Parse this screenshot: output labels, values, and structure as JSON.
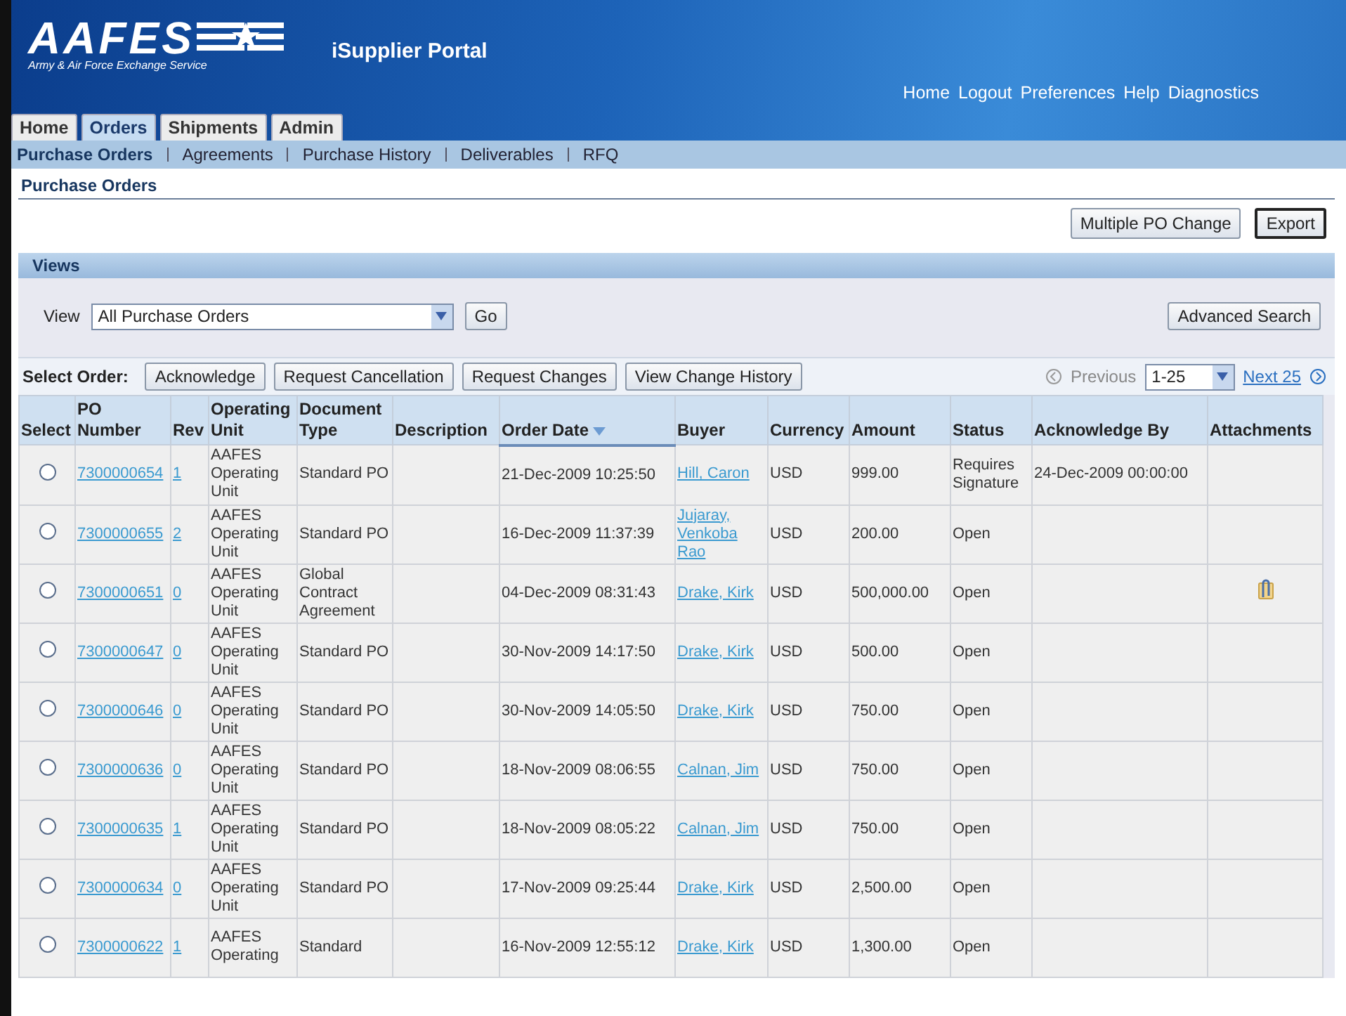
{
  "header": {
    "logo_text": "AAFES",
    "logo_subtitle": "Army & Air Force Exchange Service",
    "title": "iSupplier Portal",
    "global_links": [
      "Home",
      "Logout",
      "Preferences",
      "Help",
      "Diagnostics"
    ]
  },
  "tabs": [
    {
      "label": "Home",
      "selected": false
    },
    {
      "label": "Orders",
      "selected": true
    },
    {
      "label": "Shipments",
      "selected": false
    },
    {
      "label": "Admin",
      "selected": false
    }
  ],
  "subtabs": [
    {
      "label": "Purchase Orders",
      "selected": true
    },
    {
      "label": "Agreements",
      "selected": false
    },
    {
      "label": "Purchase History",
      "selected": false
    },
    {
      "label": "Deliverables",
      "selected": false
    },
    {
      "label": "RFQ",
      "selected": false
    }
  ],
  "page_title": "Purchase Orders",
  "page_buttons": [
    {
      "label": "Multiple PO Change",
      "focused": false
    },
    {
      "label": "Export",
      "focused": true
    }
  ],
  "views": {
    "title": "Views",
    "view_label": "View",
    "view_value": "All Purchase Orders",
    "go_label": "Go",
    "advanced_search_label": "Advanced Search"
  },
  "select_order": {
    "label": "Select Order:",
    "buttons": [
      "Acknowledge",
      "Request Cancellation",
      "Request Changes",
      "View Change History"
    ],
    "previous_label": "Previous",
    "previous_disabled": true,
    "range_value": "1-25",
    "next_label": "Next 25"
  },
  "table": {
    "columns": [
      {
        "label": "Select",
        "sorted": false
      },
      {
        "label": "PO Number",
        "sorted": false
      },
      {
        "label": "Rev",
        "sorted": false
      },
      {
        "label": "Operating Unit",
        "sorted": false
      },
      {
        "label": "Document Type",
        "sorted": false
      },
      {
        "label": "Description",
        "sorted": false
      },
      {
        "label": "Order Date",
        "sorted": true
      },
      {
        "label": "Buyer",
        "sorted": false
      },
      {
        "label": "Currency",
        "sorted": false
      },
      {
        "label": "Amount",
        "sorted": false
      },
      {
        "label": "Status",
        "sorted": false
      },
      {
        "label": "Acknowledge By",
        "sorted": false
      },
      {
        "label": "Attachments",
        "sorted": false
      }
    ],
    "rows": [
      {
        "selected": false,
        "po_number": "7300000654",
        "rev": "1",
        "operating_unit": "AAFES Operating Unit",
        "document_type": "Standard PO",
        "order_date": "21-Dec-2009 10:25:50",
        "buyer": "Hill, Caron",
        "currency": "USD",
        "amount": "999.00",
        "status": "Requires Signature",
        "acknowledge_by": "24-Dec-2009 00:00:00",
        "attachment": false
      },
      {
        "selected": false,
        "po_number": "7300000655",
        "rev": "2",
        "operating_unit": "AAFES Operating Unit",
        "document_type": "Standard PO",
        "order_date": "16-Dec-2009 11:37:39",
        "buyer": "Jujaray, Venkoba Rao",
        "currency": "USD",
        "amount": "200.00",
        "status": "Open",
        "acknowledge_by": "",
        "attachment": false
      },
      {
        "selected": false,
        "po_number": "7300000651",
        "rev": "0",
        "operating_unit": "AAFES Operating Unit",
        "document_type": "Global Contract Agreement",
        "order_date": "04-Dec-2009 08:31:43",
        "buyer": "Drake, Kirk",
        "currency": "USD",
        "amount": "500,000.00",
        "status": "Open",
        "acknowledge_by": "",
        "attachment": true
      },
      {
        "selected": false,
        "po_number": "7300000647",
        "rev": "0",
        "operating_unit": "AAFES Operating Unit",
        "document_type": "Standard PO",
        "order_date": "30-Nov-2009 14:17:50",
        "buyer": "Drake, Kirk",
        "currency": "USD",
        "amount": "500.00",
        "status": "Open",
        "acknowledge_by": "",
        "attachment": false
      },
      {
        "selected": false,
        "po_number": "7300000646",
        "rev": "0",
        "operating_unit": "AAFES Operating Unit",
        "document_type": "Standard PO",
        "order_date": "30-Nov-2009 14:05:50",
        "buyer": "Drake, Kirk",
        "currency": "USD",
        "amount": "750.00",
        "status": "Open",
        "acknowledge_by": "",
        "attachment": false
      },
      {
        "selected": false,
        "po_number": "7300000636",
        "rev": "0",
        "operating_unit": "AAFES Operating Unit",
        "document_type": "Standard PO",
        "order_date": "18-Nov-2009 08:06:55",
        "buyer": "Calnan, Jim",
        "currency": "USD",
        "amount": "750.00",
        "status": "Open",
        "acknowledge_by": "",
        "attachment": false
      },
      {
        "selected": false,
        "po_number": "7300000635",
        "rev": "1",
        "operating_unit": "AAFES Operating Unit",
        "document_type": "Standard PO",
        "order_date": "18-Nov-2009 08:05:22",
        "buyer": "Calnan, Jim",
        "currency": "USD",
        "amount": "750.00",
        "status": "Open",
        "acknowledge_by": "",
        "attachment": false
      },
      {
        "selected": false,
        "po_number": "7300000634",
        "rev": "0",
        "operating_unit": "AAFES Operating Unit",
        "document_type": "Standard PO",
        "order_date": "17-Nov-2009 09:25:44",
        "buyer": "Drake, Kirk",
        "currency": "USD",
        "amount": "2,500.00",
        "status": "Open",
        "acknowledge_by": "",
        "attachment": false
      },
      {
        "selected": false,
        "po_number": "7300000622",
        "rev": "1",
        "operating_unit": "AAFES Operating",
        "document_type": "Standard",
        "order_date": "16-Nov-2009 12:55:12",
        "buyer": "Drake, Kirk",
        "currency": "USD",
        "amount": "1,300.00",
        "status": "Open",
        "acknowledge_by": "",
        "attachment": false
      }
    ]
  }
}
